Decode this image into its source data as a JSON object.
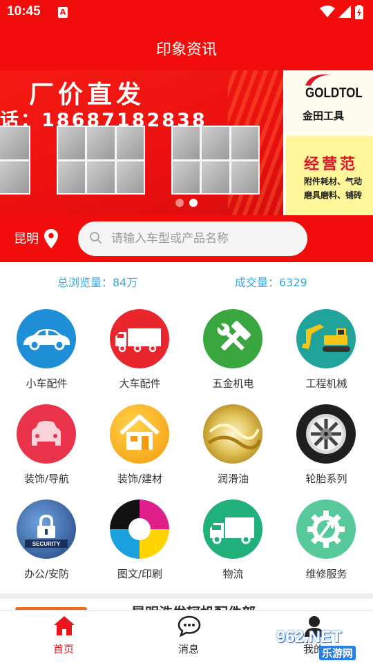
{
  "status_bar": {
    "time": "10:45",
    "notification_glyph": "A"
  },
  "header": {
    "title": "印象资讯"
  },
  "banner": {
    "heading": "厂价直发",
    "phone": "话：18687182838",
    "brand": "GOLDTOL",
    "brand_cn": "金田工具",
    "scope_title": "经营范",
    "scope_line1": "附件耗材、气动",
    "scope_line2": "磨具磨料、铺砖",
    "slides": 2,
    "active_slide": 2
  },
  "search": {
    "city": "昆明",
    "placeholder": "请输入车型或产品名称"
  },
  "stats": {
    "views_label": "总浏览量：84万",
    "deals_label": "成交量：6329"
  },
  "categories": [
    {
      "label": "小车配件",
      "icon": "car-icon",
      "color": "#1e8fd6"
    },
    {
      "label": "大车配件",
      "icon": "truck-icon",
      "color": "#e8262b"
    },
    {
      "label": "五金机电",
      "icon": "tools-icon",
      "color": "#3aa63f"
    },
    {
      "label": "工程机械",
      "icon": "excavator-icon",
      "color": "#1fa39a"
    },
    {
      "label": "装饰/导航",
      "icon": "car-seat-icon",
      "color": "#e8334a"
    },
    {
      "label": "装饰/建材",
      "icon": "house-icon",
      "color": "#f7a81b"
    },
    {
      "label": "润滑油",
      "icon": "oil-icon",
      "color": "#d9b44a"
    },
    {
      "label": "轮胎系列",
      "icon": "tire-icon",
      "color": "#222222"
    },
    {
      "label": "办公/安防",
      "icon": "security-lock-icon",
      "color": "#2a5fa8"
    },
    {
      "label": "图文/印刷",
      "icon": "print-colors-icon",
      "color": "#e0208a"
    },
    {
      "label": "物流",
      "icon": "delivery-truck-icon",
      "color": "#20b07a"
    },
    {
      "label": "维修服务",
      "icon": "repair-gear-icon",
      "color": "#57c99a"
    }
  ],
  "peek": {
    "text": "昆明浩发轲机配件部"
  },
  "tabs": [
    {
      "label": "首页",
      "icon": "home-icon",
      "active": true
    },
    {
      "label": "消息",
      "icon": "chat-icon",
      "active": false
    },
    {
      "label": "我的",
      "icon": "user-icon",
      "active": false
    }
  ],
  "watermark": {
    "text1": "962.NET",
    "text2": "乐游网"
  },
  "colors": {
    "primary": "#f20d0d",
    "stat_blue": "#3ba7e0",
    "tab_active": "#e8151b",
    "tab_inactive": "#333333"
  }
}
